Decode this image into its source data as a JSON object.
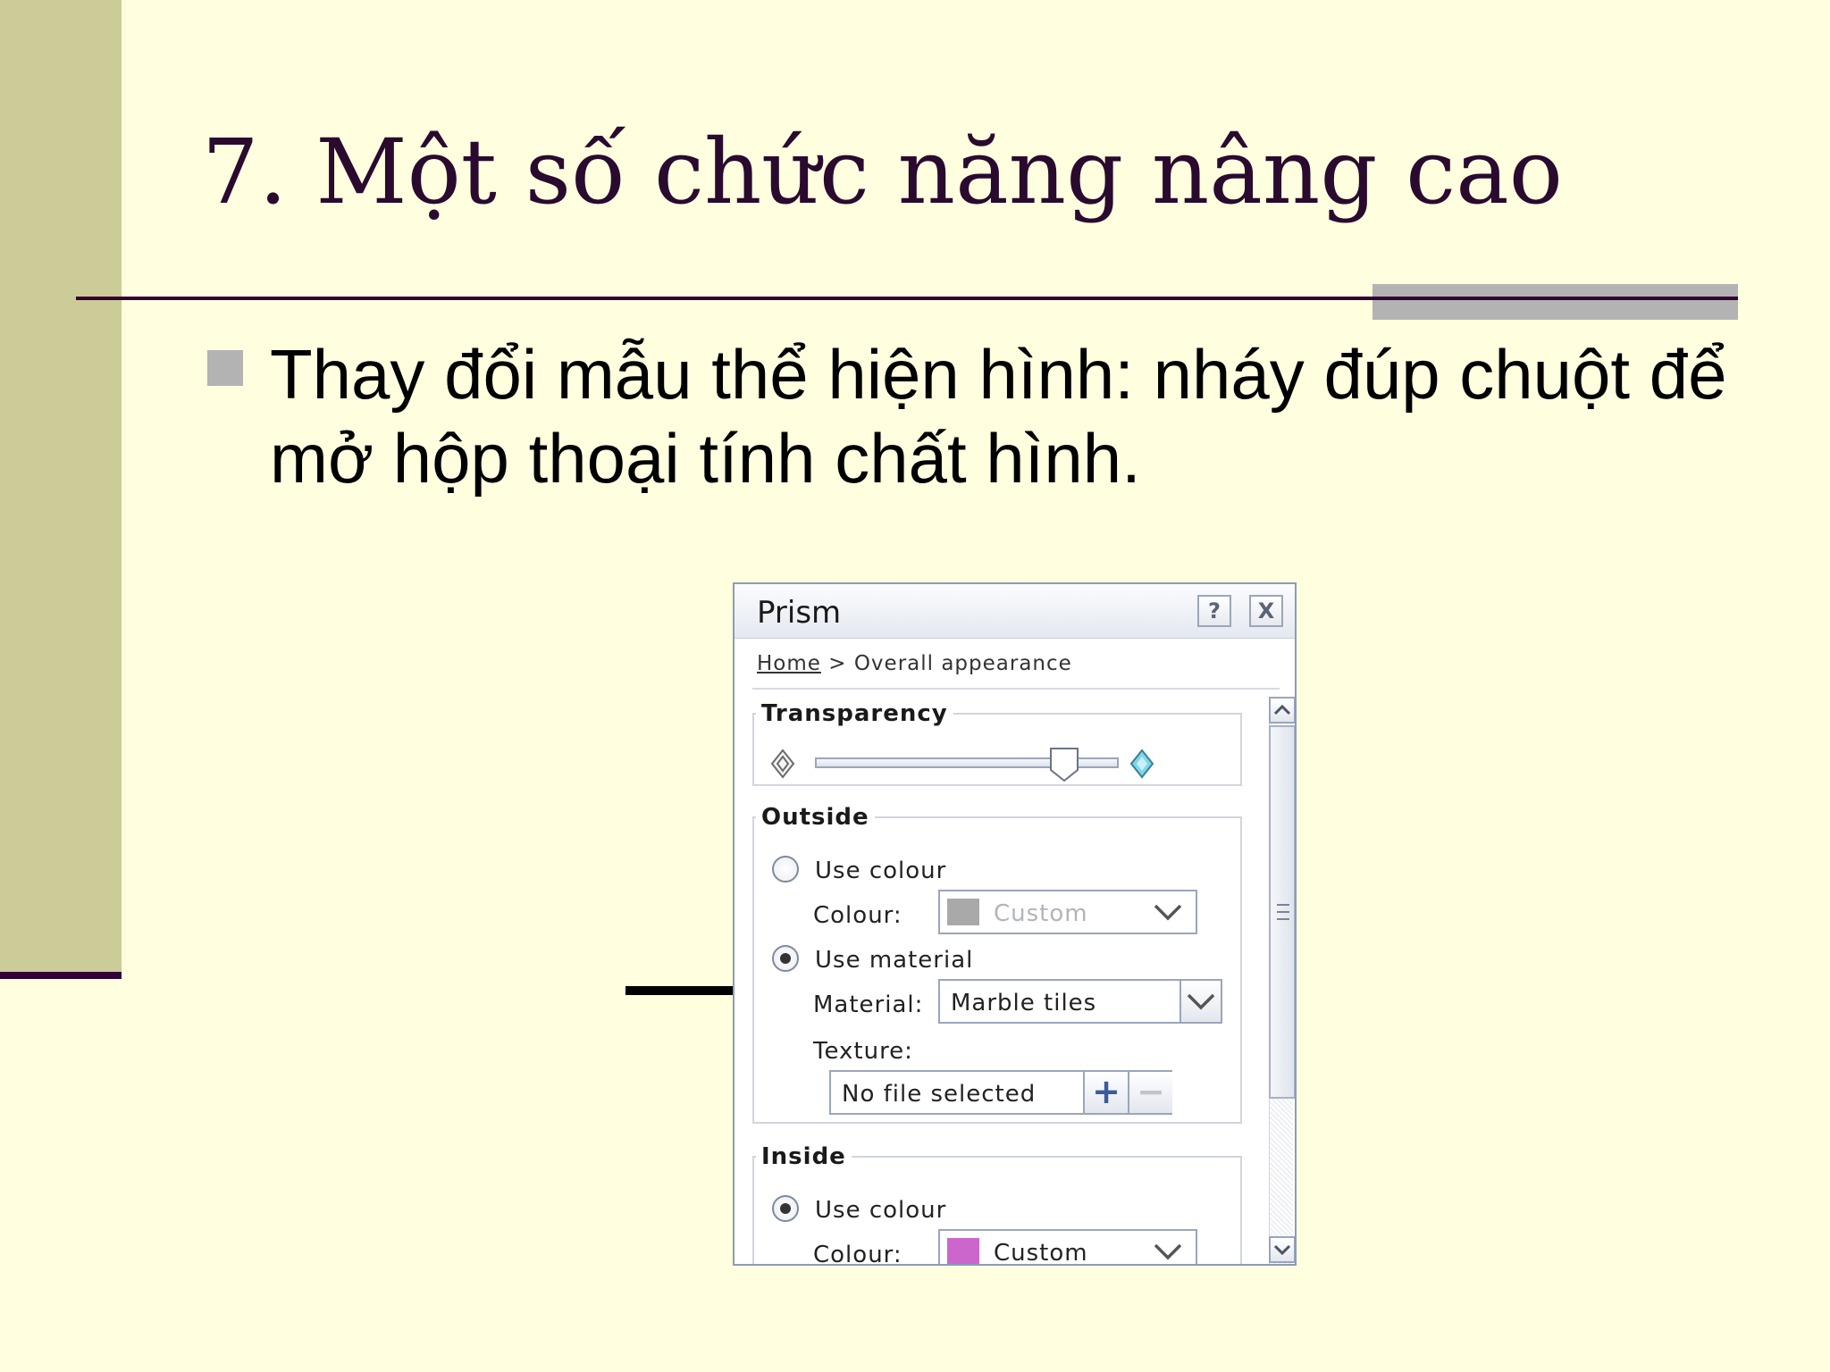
{
  "slide": {
    "title": "7. Một số chức năng nâng cao",
    "bullet": "Thay đổi mẫu thể hiện hình: nháy đúp chuột để mở hộp thoại tính chất hình."
  },
  "dialog": {
    "title": "Prism",
    "help_icon": "?",
    "close_icon": "X",
    "breadcrumb": {
      "home": "Home",
      "separator": " > ",
      "current": "Overall appearance"
    },
    "transparency": {
      "legend": "Transparency",
      "level": 0.85
    },
    "outside": {
      "legend": "Outside",
      "use_colour_label": "Use colour",
      "colour_label": "Colour:",
      "colour_value": "Custom",
      "colour_swatch": "#a9a9a9",
      "use_material_label": "Use material",
      "material_label": "Material:",
      "material_value": "Marble tiles",
      "texture_label": "Texture:",
      "texture_value": "No file selected",
      "texture_add": "+",
      "texture_remove": "−",
      "selected": "use_material"
    },
    "inside": {
      "legend": "Inside",
      "use_colour_label": "Use colour",
      "colour_label": "Colour:",
      "colour_value": "Custom",
      "colour_swatch": "#cc66cc",
      "selected": "use_colour"
    }
  },
  "colors": {
    "background": "#ffffe0",
    "sidebar": "#cccc99",
    "title": "#2a0a2e",
    "accent_rule": "#330033",
    "bullet": "#b3b3b3"
  }
}
